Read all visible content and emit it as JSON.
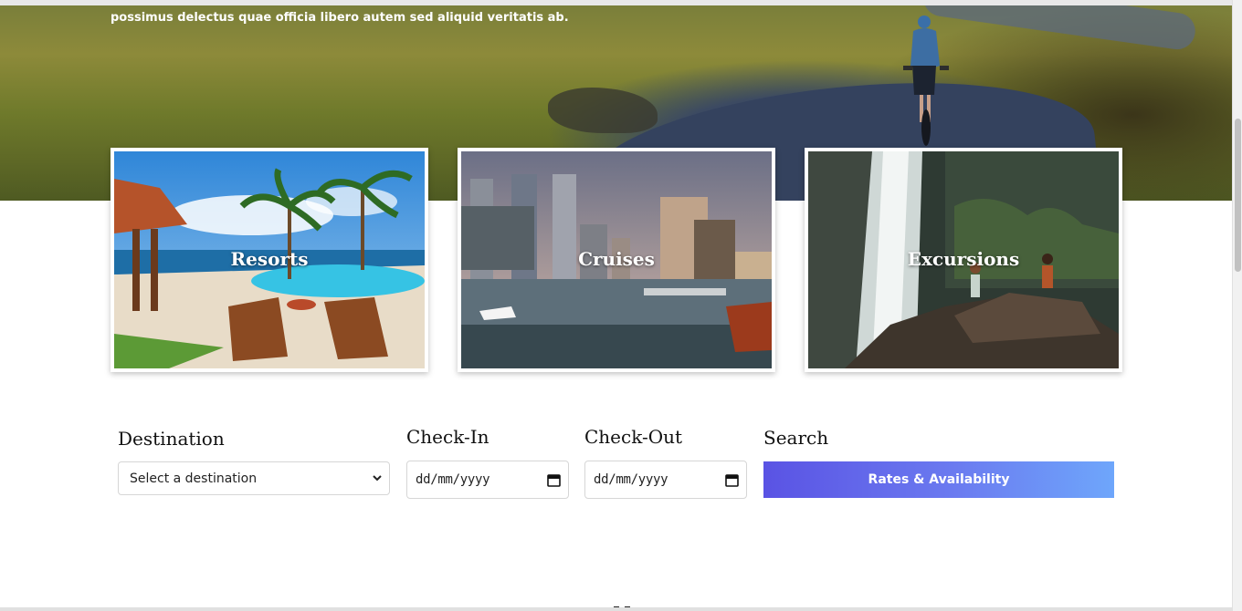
{
  "hero": {
    "text": "possimus delectus quae officia libero autem sed aliquid veritatis ab."
  },
  "categories": [
    {
      "label": "Resorts"
    },
    {
      "label": "Cruises"
    },
    {
      "label": "Excursions"
    }
  ],
  "booking": {
    "destination_label": "Destination",
    "destination_value": "Select a destination",
    "checkin_label": "Check-In",
    "checkin_placeholder": "dd/mm/yyyy",
    "checkout_label": "Check-Out",
    "checkout_placeholder": "dd/mm/yyyy",
    "search_label": "Search",
    "search_button": "Rates & Availability"
  },
  "colors": {
    "button_start": "#5a53e4",
    "button_end": "#6ea6fb"
  }
}
